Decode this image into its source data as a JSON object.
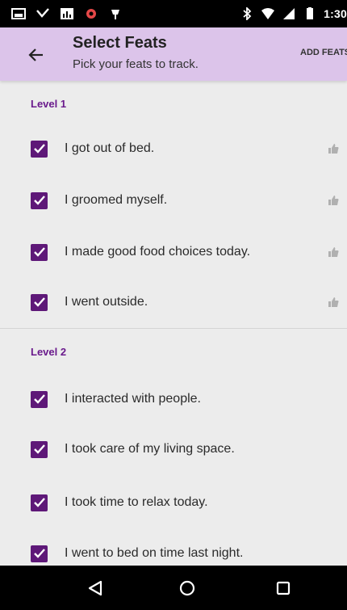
{
  "app_bar": {
    "title": "Select Feats",
    "subtitle": "Pick your feats to track.",
    "action_label": "ADD FEATS"
  },
  "status_bar": {
    "time": "1:30"
  },
  "sections": [
    {
      "header": "Level 1",
      "items": [
        {
          "label": "I got out of bed.",
          "checked": true,
          "has_thumb": true
        },
        {
          "label": "I groomed myself.",
          "checked": true,
          "has_thumb": true
        },
        {
          "label": "I made good food choices today.",
          "checked": true,
          "has_thumb": true
        },
        {
          "label": "I went outside.",
          "checked": true,
          "has_thumb": true
        }
      ]
    },
    {
      "header": "Level 2",
      "items": [
        {
          "label": "I interacted with people.",
          "checked": true,
          "has_thumb": false
        },
        {
          "label": "I took care of my living space.",
          "checked": true,
          "has_thumb": false
        },
        {
          "label": "I took time to relax today.",
          "checked": true,
          "has_thumb": false
        },
        {
          "label": "I went to bed on time last night.",
          "checked": true,
          "has_thumb": false
        }
      ]
    }
  ],
  "colors": {
    "app_bar": "#dcc4ea",
    "accent": "#5e1878",
    "section_header": "#6a1a8c",
    "background": "#ececec"
  },
  "icons": {
    "back": "arrow-back-icon",
    "check": "check-icon",
    "thumb": "thumb-up-icon",
    "nav_back": "triangle-back-icon",
    "nav_home": "circle-home-icon",
    "nav_recents": "square-recents-icon"
  }
}
